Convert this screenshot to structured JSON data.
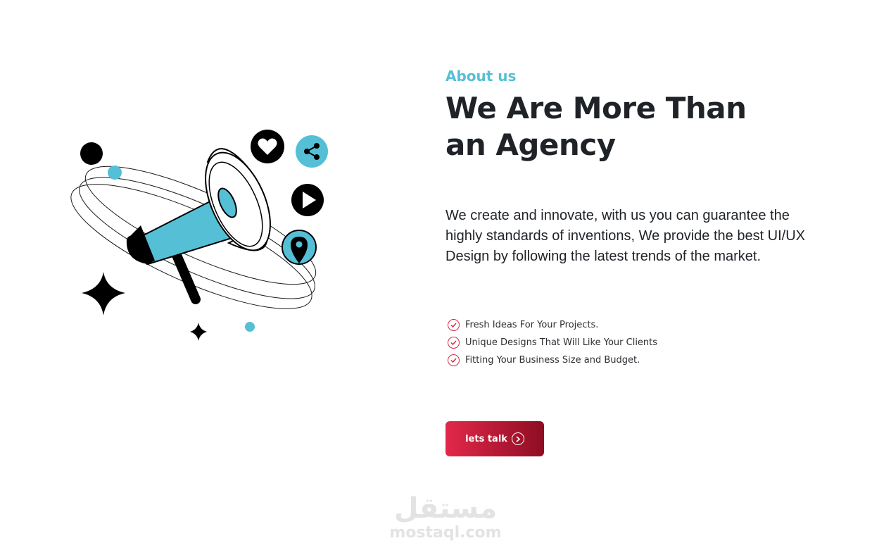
{
  "about": {
    "eyebrow": "About us",
    "title_line1": "We Are More Than",
    "title_line2": "an Agency",
    "description": "We create and innovate, with us you can guarantee the highly standards of inventions, We provide the best UI/UX Design by following the latest trends of the market.",
    "features": [
      "Fresh Ideas For Your Projects.",
      "Unique Designs That Will Like Your Clients",
      "Fitting Your Business Size and Budget."
    ],
    "cta_label": "lets talk"
  },
  "illustration": {
    "icons": [
      "megaphone-icon",
      "heart-icon",
      "share-icon",
      "play-icon",
      "location-pin-icon",
      "sparkle-icon"
    ]
  },
  "watermark": {
    "logo_text": "مستقل",
    "url": "mostaql.com"
  },
  "colors": {
    "accent_teal": "#55bfd6",
    "cta_start": "#e2284a",
    "cta_end": "#8e0d22",
    "check_red": "#d92849",
    "text_dark": "#1f2328"
  }
}
